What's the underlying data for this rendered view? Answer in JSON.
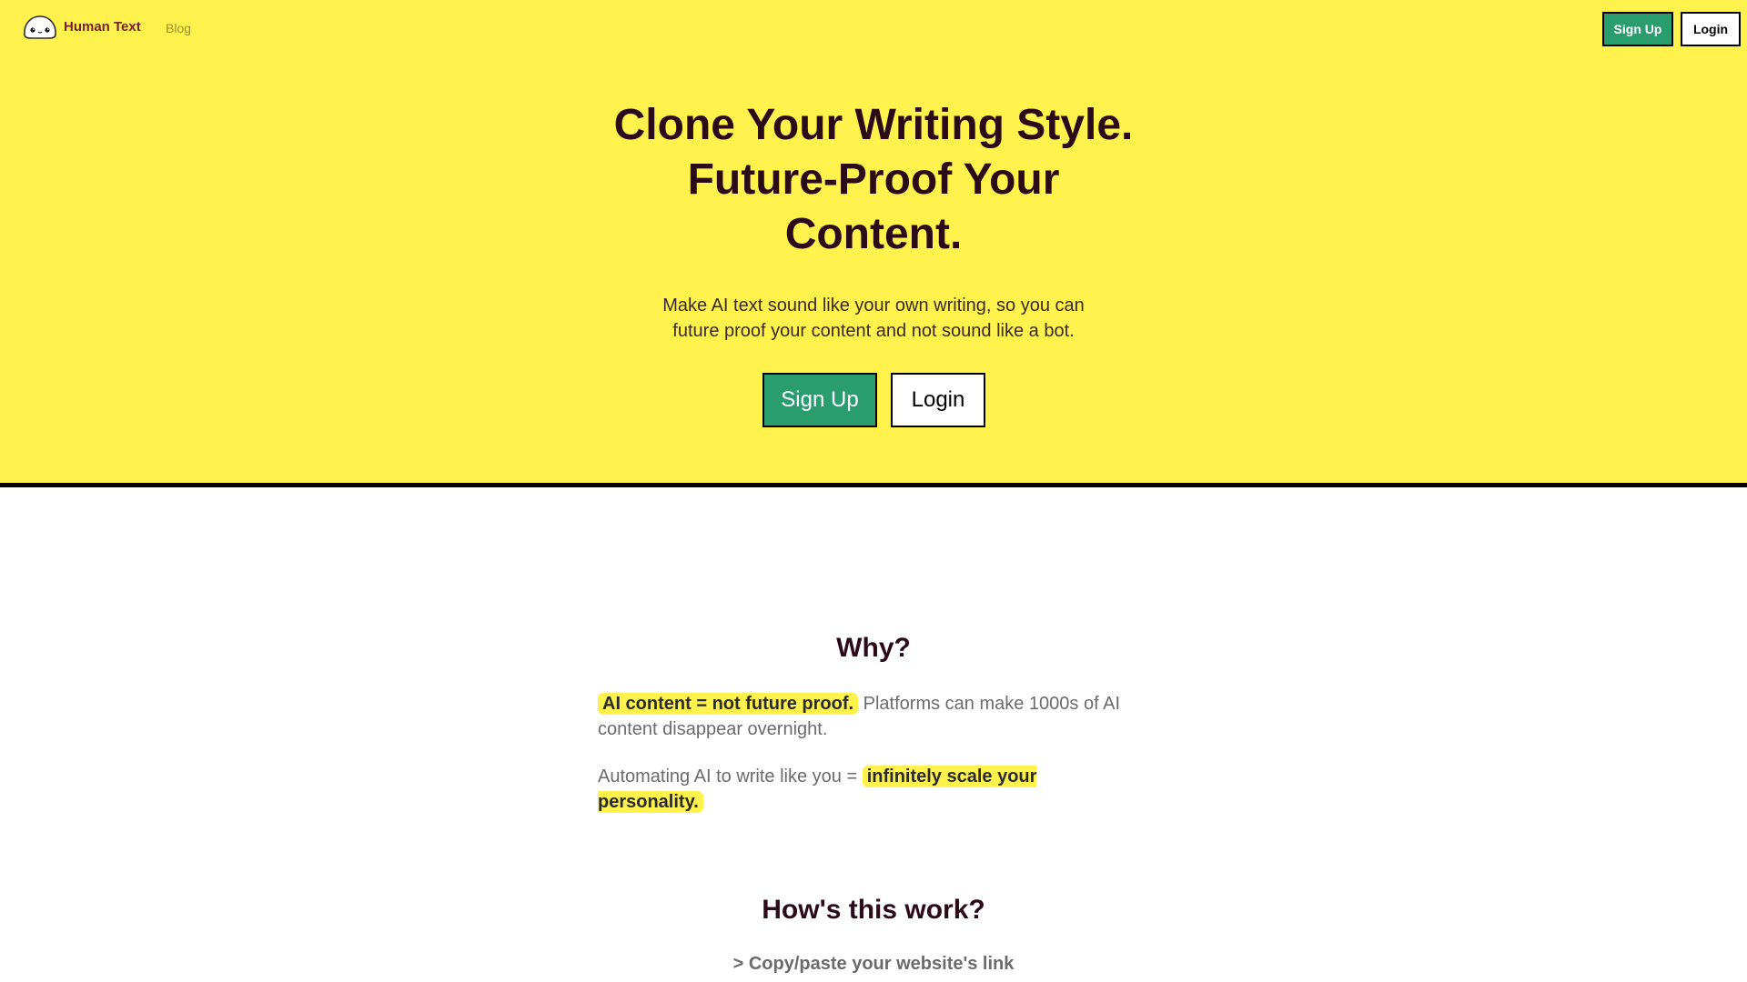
{
  "nav": {
    "brand_name": "Human Text",
    "logo_icon": "blob-face-icon",
    "blog_label": "Blog",
    "signup_label": "Sign Up",
    "login_label": "Login"
  },
  "hero": {
    "title": "Clone Your Writing Style. Future-Proof Your Content.",
    "subtitle": "Make AI text sound like your own writing, so you can future proof your content and not sound like a bot.",
    "signup_label": "Sign Up",
    "login_label": "Login"
  },
  "why": {
    "title": "Why?",
    "p1_highlight": "AI content = not future proof.",
    "p1_rest": " Platforms can make 1000s of AI content disappear overnight.",
    "p2_prefix": "Automating AI to write like you = ",
    "p2_highlight": "infinitely scale your personality."
  },
  "how": {
    "title": "How's this work?",
    "step1": "> Copy/paste your website's link"
  },
  "colors": {
    "hero_bg": "#fff24d",
    "accent_green": "#2a9d6f",
    "heading": "#2b0a1a",
    "brand_text": "#7a1f2b"
  }
}
